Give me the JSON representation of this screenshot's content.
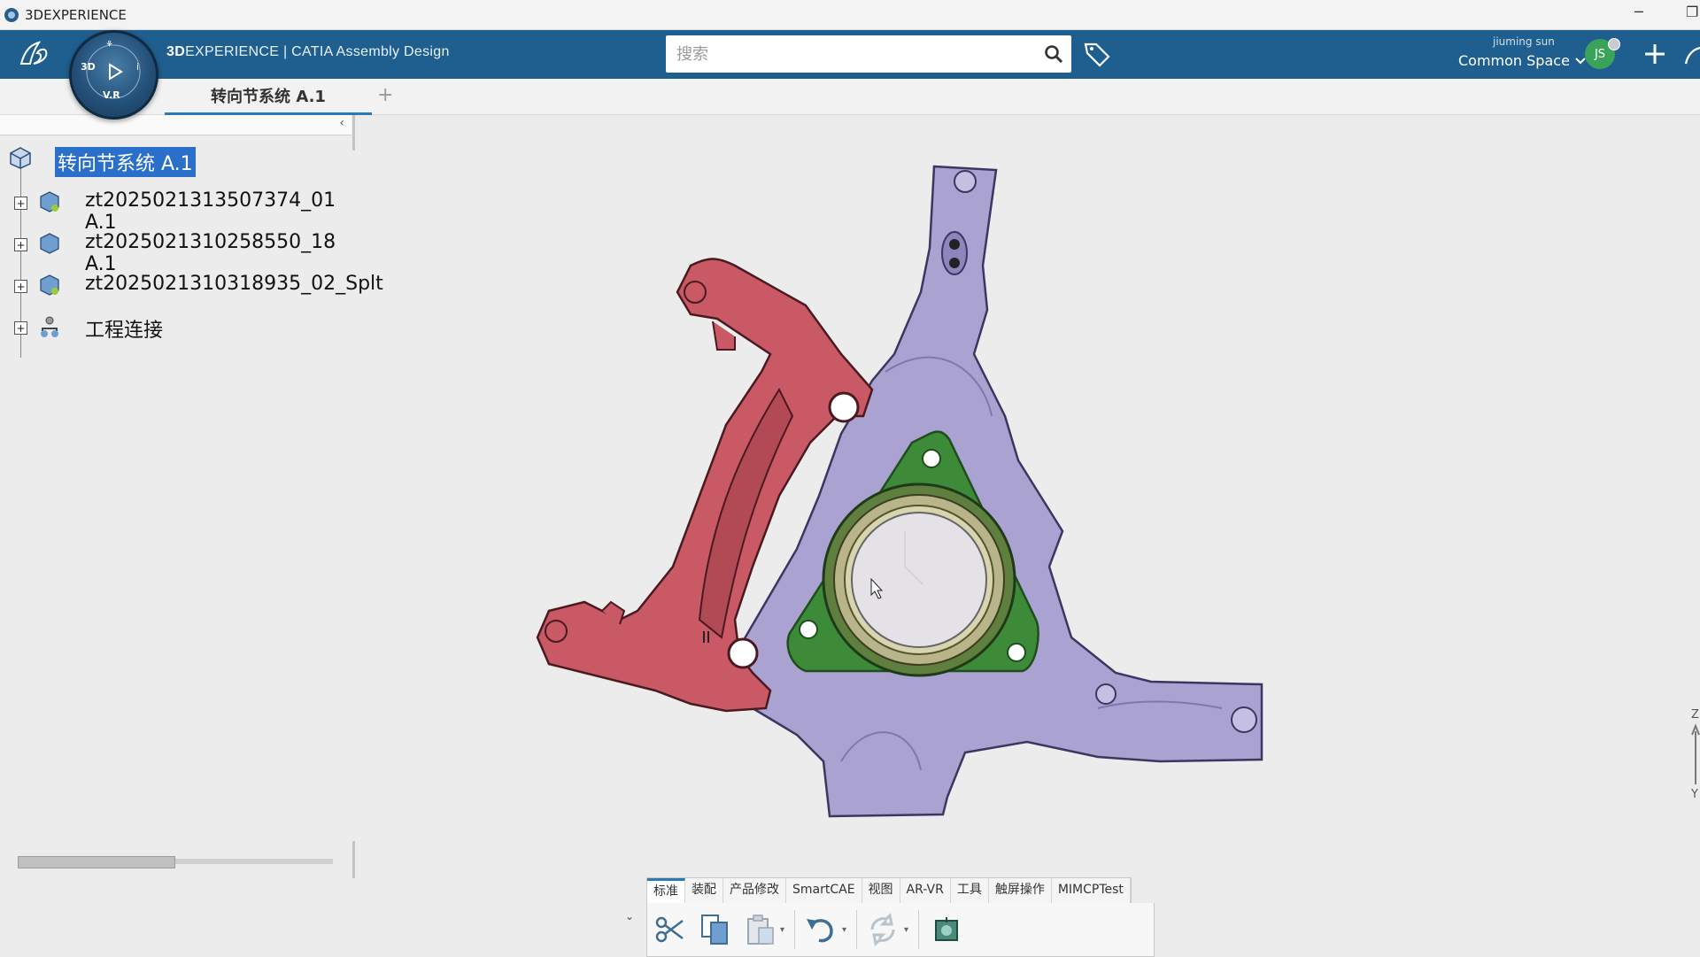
{
  "window": {
    "title": "3DEXPERIENCE",
    "minimize_label": "─",
    "restore_label": "❐"
  },
  "topbar": {
    "brand_bold": "3D",
    "brand_rest": "EXPERIENCE | CATIA Assembly Design",
    "search_placeholder": "搜索",
    "user_name": "jiuming sun",
    "space": "Common Space",
    "avatar_initials": "JS",
    "compass": {
      "label_3d": "3D",
      "label_vr": "V.R",
      "label_i": "i"
    }
  },
  "tabs": {
    "active": "转向节系统 A.1",
    "add_label": "+"
  },
  "tree": {
    "collapse_label": "‹",
    "root": "转向节系统 A.1",
    "children": [
      {
        "label": "zt2025021313507374_01 A.1"
      },
      {
        "label": "zt2025021310258550_18 A.1"
      },
      {
        "label": "zt2025021310318935_02_Splt"
      },
      {
        "label": "工程连接"
      }
    ]
  },
  "action_bar": {
    "tabs": [
      "标准",
      "装配",
      "产品修改",
      "SmartCAE",
      "视图",
      "AR-VR",
      "工具",
      "触屏操作",
      "MIMCPTest"
    ],
    "active_tab": 0,
    "toggle_label": "⌄",
    "dropdown_label": "▾"
  },
  "axis": {
    "z": "Z",
    "y": "Y"
  },
  "colors": {
    "topbar": "#1f5f8f",
    "caliper": "#c95a66",
    "knuckle": "#a9a2cf",
    "flange": "#3f8a3a",
    "bearing_ring": "#b8b48a",
    "selection": "#2a6fc9"
  }
}
